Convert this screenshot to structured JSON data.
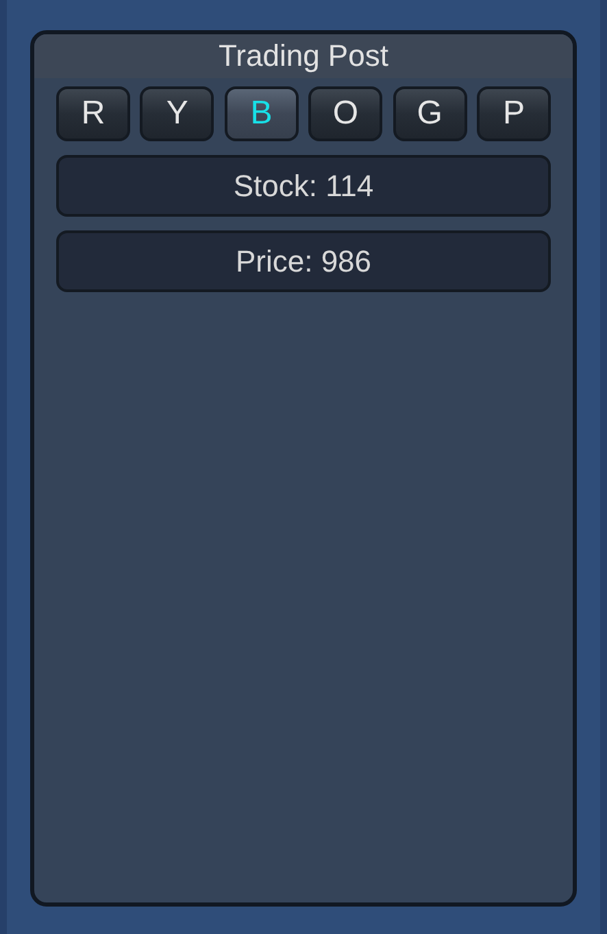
{
  "panel": {
    "title": "Trading Post"
  },
  "color_buttons": [
    {
      "label": "R",
      "selected": false
    },
    {
      "label": "Y",
      "selected": false
    },
    {
      "label": "B",
      "selected": true
    },
    {
      "label": "O",
      "selected": false
    },
    {
      "label": "G",
      "selected": false
    },
    {
      "label": "P",
      "selected": false
    }
  ],
  "stats": [
    {
      "text": "Stock: 114"
    },
    {
      "text": "Price: 986"
    }
  ]
}
